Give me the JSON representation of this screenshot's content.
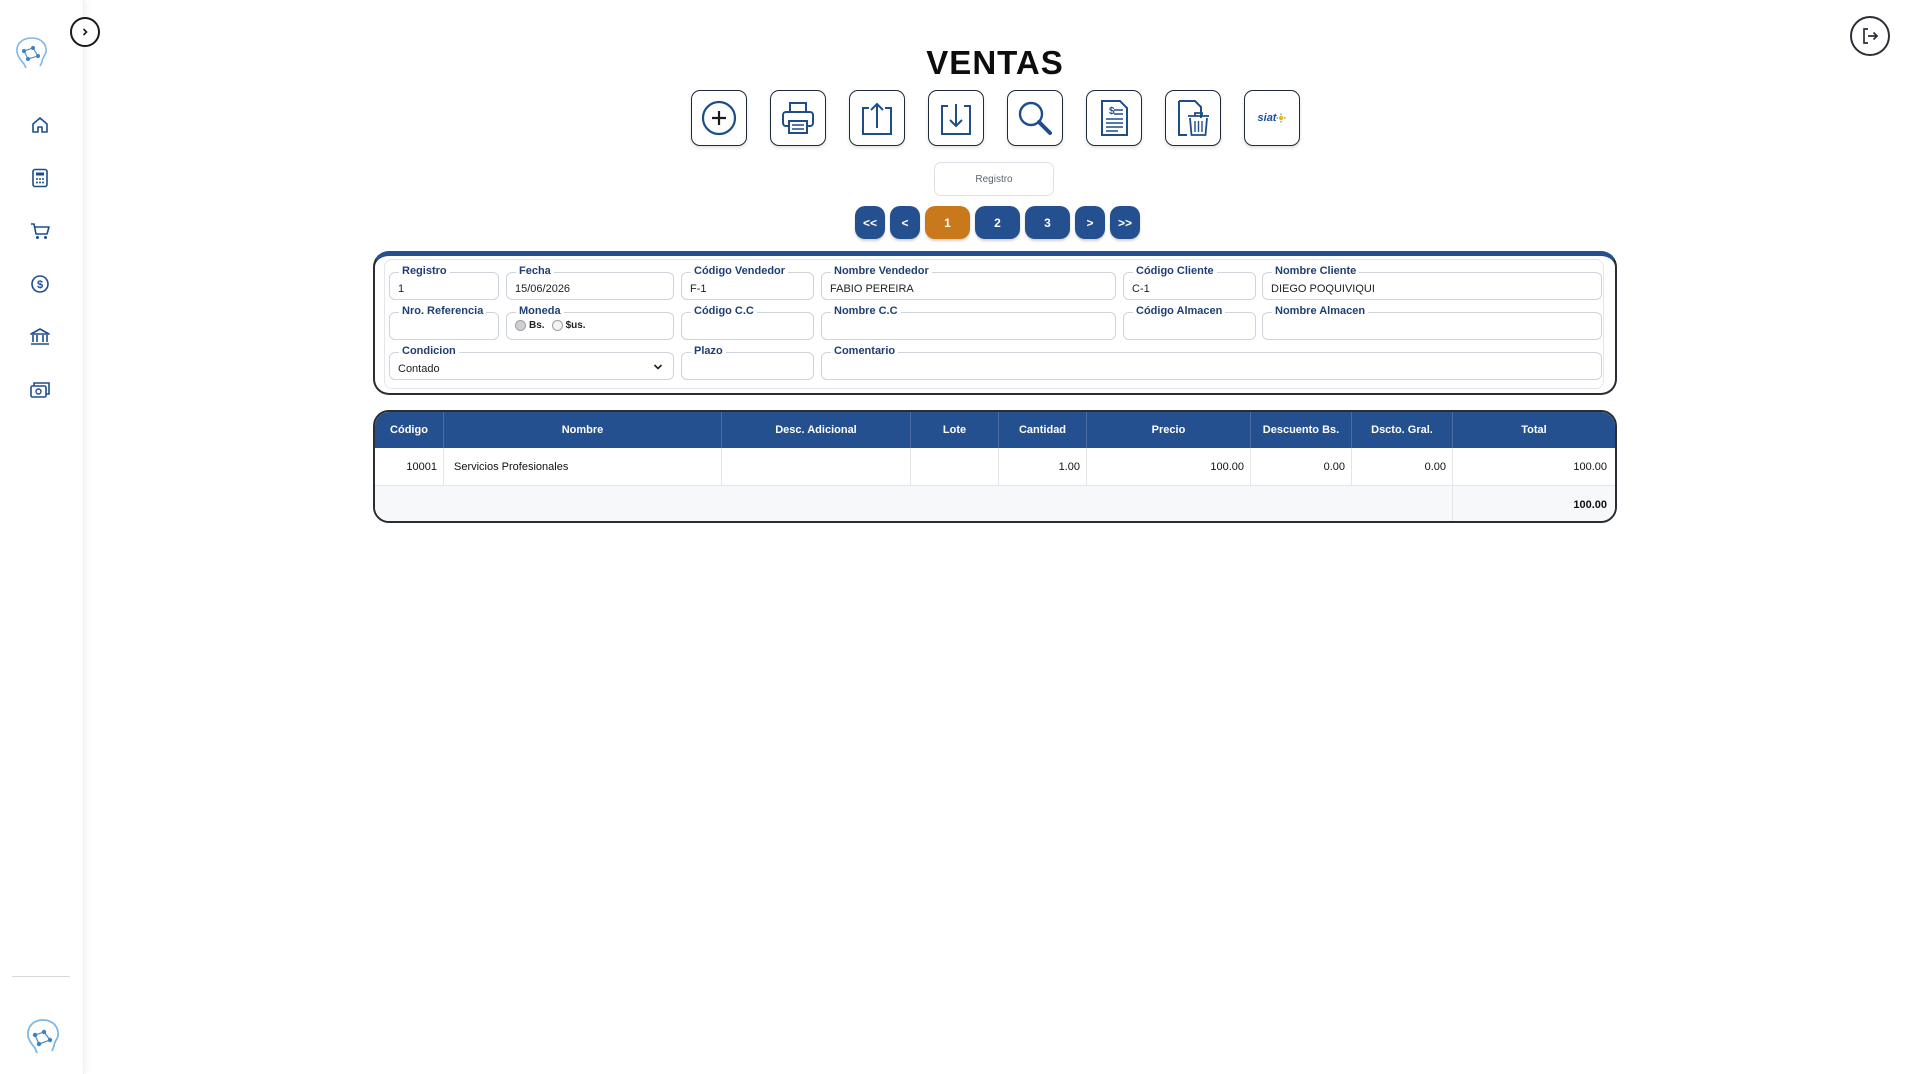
{
  "page": {
    "title": "VENTAS"
  },
  "sidebar": {
    "items": [
      {
        "icon": "home-icon"
      },
      {
        "icon": "calculator-icon"
      },
      {
        "icon": "cart-icon"
      },
      {
        "icon": "dollar-icon"
      },
      {
        "icon": "bank-icon"
      },
      {
        "icon": "money-icon"
      }
    ]
  },
  "toolbar": {
    "buttons": [
      {
        "name": "add-button",
        "icon": "plus-circle-icon"
      },
      {
        "name": "print-button",
        "icon": "printer-icon"
      },
      {
        "name": "upload-button",
        "icon": "upload-icon"
      },
      {
        "name": "download-button",
        "icon": "download-icon"
      },
      {
        "name": "search-button",
        "icon": "magnifier-icon"
      },
      {
        "name": "invoice-button",
        "icon": "invoice-doc-icon"
      },
      {
        "name": "delete-button",
        "icon": "trash-doc-icon"
      },
      {
        "name": "siat-button",
        "label": "siat"
      }
    ]
  },
  "registro": {
    "placeholder": "Registro"
  },
  "pager": {
    "first": "<<",
    "prev": "<",
    "pages": [
      "1",
      "2",
      "3"
    ],
    "active": "1",
    "next": ">",
    "last": ">>"
  },
  "form": {
    "registro": {
      "label": "Registro",
      "value": "1"
    },
    "fecha": {
      "label": "Fecha",
      "value": "15/06/2026"
    },
    "codigo_vendedor": {
      "label": "Código Vendedor",
      "value": "F-1"
    },
    "nombre_vendedor": {
      "label": "Nombre Vendedor",
      "value": "FABIO PEREIRA"
    },
    "codigo_cliente": {
      "label": "Código Cliente",
      "value": "C-1"
    },
    "nombre_cliente": {
      "label": "Nombre Cliente",
      "value": "DIEGO POQUIVIQUI"
    },
    "nro_referencia": {
      "label": "Nro. Referencia",
      "value": ""
    },
    "moneda": {
      "label": "Moneda",
      "options": [
        "Bs.",
        "$us."
      ],
      "selected": "Bs."
    },
    "codigo_cc": {
      "label": "Código C.C",
      "value": ""
    },
    "nombre_cc": {
      "label": "Nombre C.C",
      "value": ""
    },
    "codigo_almacen": {
      "label": "Código Almacen",
      "value": ""
    },
    "nombre_almacen": {
      "label": "Nombre Almacen",
      "value": ""
    },
    "condicion": {
      "label": "Condicion",
      "value": "Contado"
    },
    "plazo": {
      "label": "Plazo",
      "value": ""
    },
    "comentario": {
      "label": "Comentario",
      "value": ""
    }
  },
  "table": {
    "headers": [
      "Código",
      "Nombre",
      "Desc. Adicional",
      "Lote",
      "Cantidad",
      "Precio",
      "Descuento Bs.",
      "Dscto. Gral.",
      "Total"
    ],
    "rows": [
      {
        "codigo": "10001",
        "nombre": "Servicios Profesionales",
        "desc": "",
        "lote": "",
        "cantidad": "1.00",
        "precio": "100.00",
        "descuento": "0.00",
        "dscto_gral": "0.00",
        "total": "100.00"
      }
    ],
    "grand_total": "100.00"
  },
  "colors": {
    "primary": "#24508f",
    "active_page": "#c9781c"
  }
}
